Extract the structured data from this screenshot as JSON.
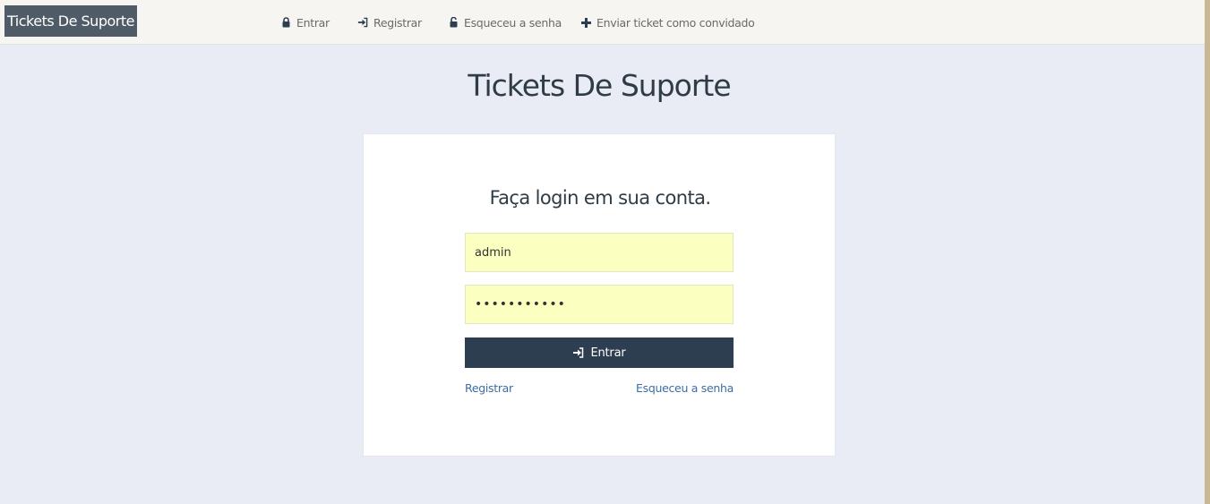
{
  "brand": {
    "title": "Tickets De Suporte"
  },
  "nav": {
    "items": [
      {
        "label": "Entrar",
        "icon": "lock-icon"
      },
      {
        "label": "Registrar",
        "icon": "sign-in-icon"
      },
      {
        "label": "Esqueceu a senha",
        "icon": "unlock-icon"
      },
      {
        "label": "Enviar ticket como convidado",
        "icon": "plus-icon"
      }
    ]
  },
  "page": {
    "title": "Tickets De Suporte"
  },
  "login": {
    "heading": "Faça login em sua conta.",
    "username_value": "admin",
    "password_value": "•••••••••••",
    "submit_label": "Entrar",
    "register_link": "Registrar",
    "forgot_link": "Esqueceu a senha"
  },
  "colors": {
    "brand_bg": "#4f5b66",
    "button_bg": "#2c3e50",
    "input_bg": "#fbffbf",
    "link": "#3a6ea5",
    "page_bg": "#e9ecf5"
  }
}
